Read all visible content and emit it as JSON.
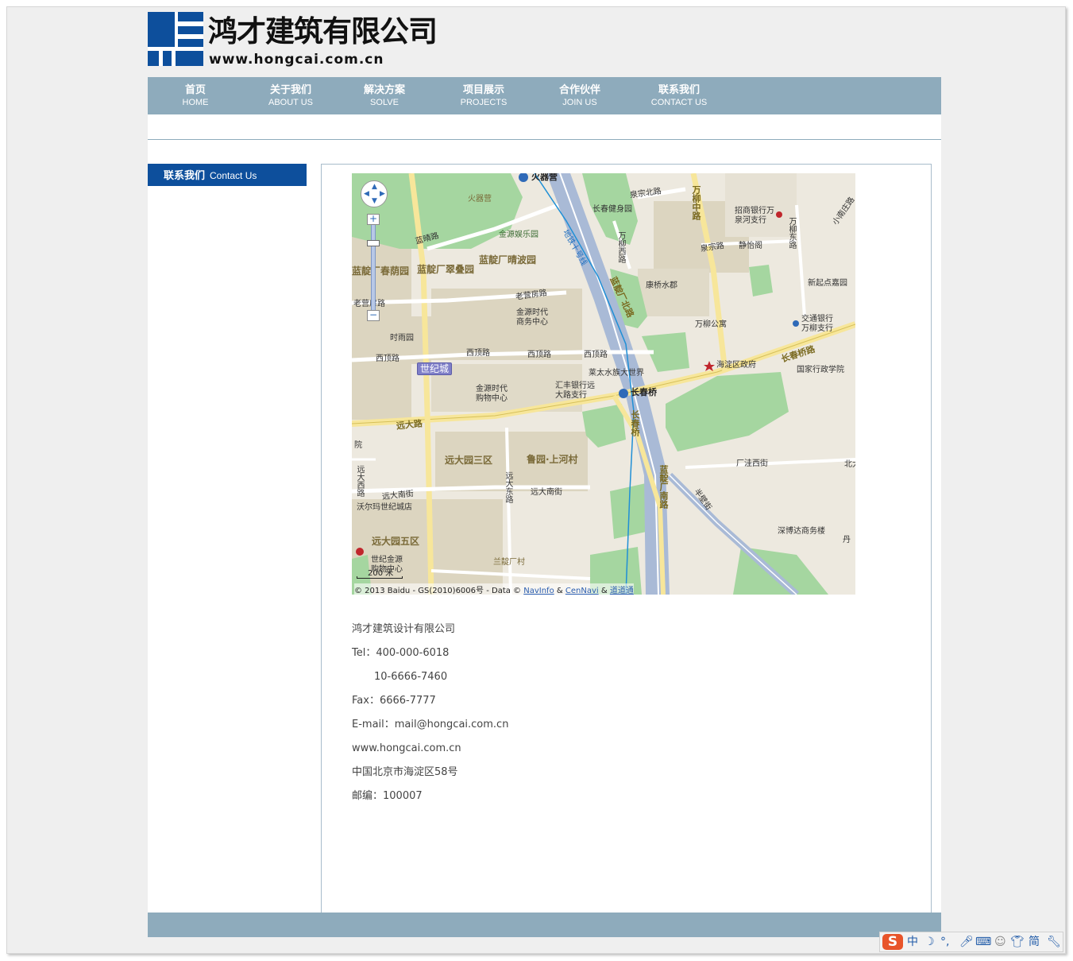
{
  "brand": {
    "name_cn": "鸿才建筑有限公司",
    "url": "www.hongcai.com.cn"
  },
  "nav": [
    {
      "cn": "首页",
      "en": "HOME"
    },
    {
      "cn": "关于我们",
      "en": "ABOUT US"
    },
    {
      "cn": "解决方案",
      "en": "SOLVE"
    },
    {
      "cn": "项目展示",
      "en": "PROJECTS"
    },
    {
      "cn": "合作伙伴",
      "en": "JOIN US"
    },
    {
      "cn": "联系我们",
      "en": "CONTACT US"
    }
  ],
  "sidebar": {
    "title_cn": "联系我们",
    "title_en": "Contact Us"
  },
  "map": {
    "labels": {
      "huoqiying": "火器营",
      "huoqiying_station": "火器营",
      "changchun_fitness": "长春健身园",
      "quanzong_n_rd": "泉宗北路",
      "wanliu_mid_rd": "万柳中路",
      "cmb_bank": "招商银行万泉河支行",
      "wanliu_e_rd": "万柳东路",
      "xiaonanzhuang": "小南庄路",
      "lanting_rd": "蓝晴路",
      "jinyuan_park": "金源娱乐园",
      "wanliu_w_rd": "万柳西路",
      "quanzong_rd": "泉宗路",
      "jingyi_ge": "静怡阁",
      "qimingyuan": "蓝靛厂春荫园",
      "cuidieyuan": "蓝靛厂翠叠园",
      "qingboyuan": "蓝靛厂晴波园",
      "line10": "地铁十号线",
      "kangqiao": "康桥水郡",
      "xinqidian": "新起点嘉园",
      "laoying_rd": "老营房路",
      "laoying_rd2": "老营房路",
      "jinyuan_biz": "金源时代商务中心",
      "landian_n_rd": "蓝靛厂北路",
      "wanliu_apt": "万柳公寓",
      "bocom": "交通银行万柳支行",
      "shiyuyuan": "时雨园",
      "xiding_rd1": "西顶路",
      "xiding_rd2": "西顶路",
      "xiding_rd3": "西顶路",
      "xiding_rd4": "西顶路",
      "haidian_gov": "海淀区政府",
      "changchun_bridge_rd": "长春桥路",
      "shijicheng": "世纪城",
      "laitai": "莱太水族大世界",
      "admin_school": "国家行政学院",
      "jinyuan_mall": "金源时代购物中心",
      "hfb": "汇丰银行远大路支行",
      "changchunqiao": "长春桥",
      "yuanda_rd": "远大路",
      "changchunqiao_v": "长春桥",
      "yuanda_3": "远大园三区",
      "luyuan": "鲁园·上河村",
      "chang_wa_st": "厂洼西街",
      "yuanda_w_rd": "远大西路",
      "yuanda_e_rd": "远大东路",
      "yuanda_s_st": "远大南街",
      "yuanda_s_st2": "远大南街",
      "walmart": "沃尔玛世纪城店",
      "landian_s_rd": "蓝靛厂南路",
      "banbi_st": "半壁街",
      "shenbo": "深博达商务楼",
      "yuanda_5": "远大园五区",
      "shiji_jinyuan": "世纪金源购物中心",
      "landianchang_v": "兰靛厂村",
      "yuan": "院",
      "bei_da": "北大",
      "dan": "丹"
    },
    "scale": "200 米",
    "copyright_pre": "© 2013 Baidu - GS(2010)6006号 - Data ©",
    "copyright_link1": "NavInfo",
    "copyright_amp": "&",
    "copyright_link2": "CenNavi",
    "copyright_amp2": "&",
    "copyright_link3": "道道通"
  },
  "contact": {
    "company": "鸿才建筑设计有限公司",
    "tel": "Tel：400-000-6018",
    "tel2": "10-6666-7460",
    "fax": "Fax：6666-7777",
    "email": "E-mail：mail@hongcai.com.cn",
    "web": "www.hongcai.com.cn",
    "address": "中国北京市海淀区58号",
    "postcode": "邮编：100007"
  },
  "ime": {
    "logo": "S",
    "lang": "中",
    "simp": "简"
  },
  "colors": {
    "nav_bg": "#8eabbc",
    "brand_blue": "#0d4f9c",
    "page_bg": "#efefef"
  }
}
